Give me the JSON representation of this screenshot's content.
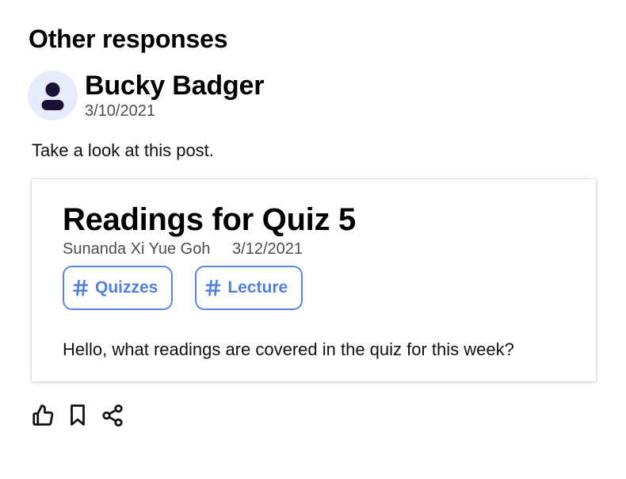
{
  "section": {
    "title": "Other responses"
  },
  "response": {
    "author": "Bucky Badger",
    "date": "3/10/2021",
    "avatar_icon": "user-icon",
    "text": "Take a look at this post."
  },
  "linked_post": {
    "title": "Readings for Quiz 5",
    "author": "Sunanda Xi Yue Goh",
    "date": "3/12/2021",
    "tags": [
      {
        "label": "Quizzes",
        "icon": "hashtag-icon"
      },
      {
        "label": "Lecture",
        "icon": "hashtag-icon"
      }
    ],
    "body": "Hello, what readings are covered in the quiz for this week?"
  },
  "actions": [
    {
      "icon": "thumbs-up-icon"
    },
    {
      "icon": "bookmark-icon"
    },
    {
      "icon": "share-icon"
    }
  ],
  "colors": {
    "accent": "#4f7fe2",
    "avatar_bg": "#e6ecfb",
    "avatar_fg": "#1b1035",
    "meta_text": "#4d4d4d"
  }
}
